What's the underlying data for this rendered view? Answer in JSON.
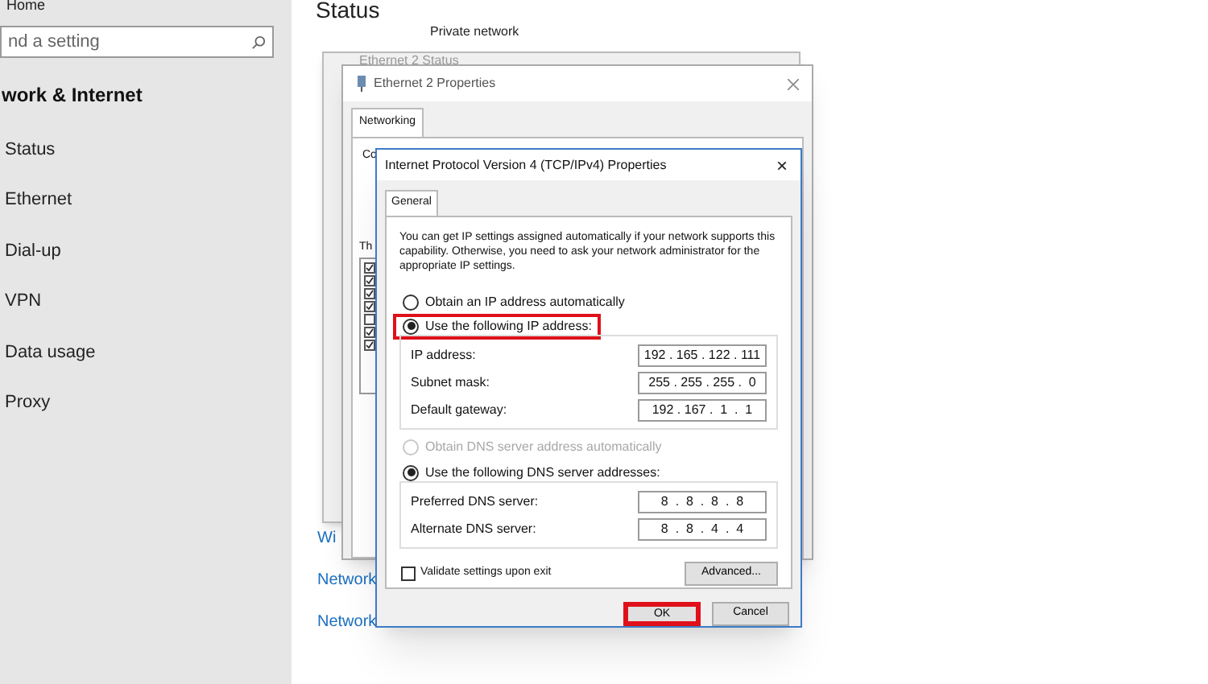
{
  "sidebar": {
    "home": "Home",
    "search": {
      "placeholder": "nd a setting"
    },
    "section": "work & Internet",
    "items": [
      {
        "label": "Status"
      },
      {
        "label": "Ethernet"
      },
      {
        "label": "Dial-up"
      },
      {
        "label": "VPN"
      },
      {
        "label": "Data usage"
      },
      {
        "label": "Proxy"
      }
    ]
  },
  "page": {
    "title": "Status",
    "network_type": "Private network",
    "links": [
      "Wi",
      "Network",
      "Network"
    ]
  },
  "status_window": {
    "title": "Ethernet 2 Status"
  },
  "properties_window": {
    "title": "Ethernet 2 Properties",
    "tabs": [
      {
        "label": "Networking",
        "selected": true
      }
    ],
    "connect_label": "Co",
    "items_label": "Th",
    "items": [
      {
        "checked": true
      },
      {
        "checked": true
      },
      {
        "checked": true
      },
      {
        "checked": true
      },
      {
        "checked": false
      },
      {
        "checked": true
      },
      {
        "checked": true
      }
    ]
  },
  "dialog": {
    "title": "Internet Protocol Version 4 (TCP/IPv4) Properties",
    "close": "×",
    "tabs": [
      {
        "label": "General",
        "selected": true
      }
    ],
    "intro": "You can get IP settings assigned automatically if your network supports this capability. Otherwise, you need to ask your network administrator for the appropriate IP settings.",
    "ip_options": [
      {
        "label": "Obtain an IP address automatically",
        "selected": false,
        "disabled": false,
        "highlighted": false
      },
      {
        "label": "Use the following IP address:",
        "selected": true,
        "disabled": false,
        "highlighted": true
      }
    ],
    "ip_fields": [
      {
        "label": "IP address:",
        "value": "192 . 165 . 122 . 111"
      },
      {
        "label": "Subnet mask:",
        "value": "255 . 255 . 255 .  0"
      },
      {
        "label": "Default gateway:",
        "value": "192 . 167 .  1  .  1"
      }
    ],
    "dns_options": [
      {
        "label": "Obtain DNS server address automatically",
        "selected": false,
        "disabled": true,
        "highlighted": false
      },
      {
        "label": "Use the following DNS server addresses:",
        "selected": true,
        "disabled": false,
        "highlighted": false
      }
    ],
    "dns_fields": [
      {
        "label": "Preferred DNS server:",
        "value": "8  .  8  .  8  .  8"
      },
      {
        "label": "Alternate DNS server:",
        "value": "8  .  8  .  4  .  4"
      }
    ],
    "validate": {
      "label": "Validate settings upon exit",
      "checked": false
    },
    "buttons": [
      {
        "label": "Advanced...",
        "highlighted": false
      },
      {
        "label": "OK",
        "highlighted": true
      },
      {
        "label": "Cancel",
        "highlighted": false
      }
    ]
  }
}
